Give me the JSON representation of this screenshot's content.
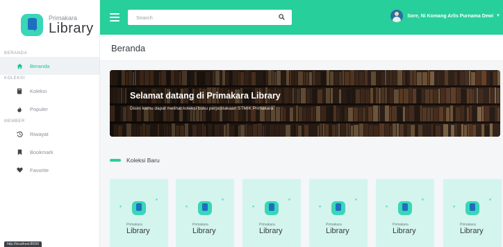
{
  "brand": {
    "top": "Primakara",
    "bottom": "Library"
  },
  "sidebar": {
    "sections": [
      {
        "label": "BERANDA"
      },
      {
        "label": "KOLEKSI"
      },
      {
        "label": "MEMBER"
      }
    ],
    "items": [
      {
        "label": "Beranda",
        "icon": "home-icon"
      },
      {
        "label": "Koleksi",
        "icon": "book-icon"
      },
      {
        "label": "Populer",
        "icon": "fire-icon"
      },
      {
        "label": "Riwayat",
        "icon": "history-icon"
      },
      {
        "label": "Bookmark",
        "icon": "bookmark-icon"
      },
      {
        "label": "Favorite",
        "icon": "heart-icon"
      }
    ]
  },
  "topbar": {
    "search_placeholder": "Search",
    "user_name": "Sore, Ni Komang Arlis Purnama Dewi"
  },
  "page": {
    "title": "Beranda"
  },
  "banner": {
    "title": "Selamat datang di Primakara Library",
    "subtitle": "Disini kamu dapat melihat koleksi buku perpustakaan STMIK Primakara"
  },
  "collection": {
    "title": "Koleksi Baru",
    "cards": [
      {
        "top": "Primakara",
        "bottom": "Library"
      },
      {
        "top": "Primakara",
        "bottom": "Library"
      },
      {
        "top": "Primakara",
        "bottom": "Library"
      },
      {
        "top": "Primakara",
        "bottom": "Library"
      },
      {
        "top": "Primakara",
        "bottom": "Library"
      },
      {
        "top": "Primakara",
        "bottom": "Library"
      }
    ]
  },
  "statusbar": {
    "text": "http://localhost:8000/"
  },
  "colors": {
    "accent": "#27cf9a",
    "logo": "#3ad6b8",
    "logo_book": "#1e6fbf",
    "card_bg": "#d3f5ee"
  }
}
